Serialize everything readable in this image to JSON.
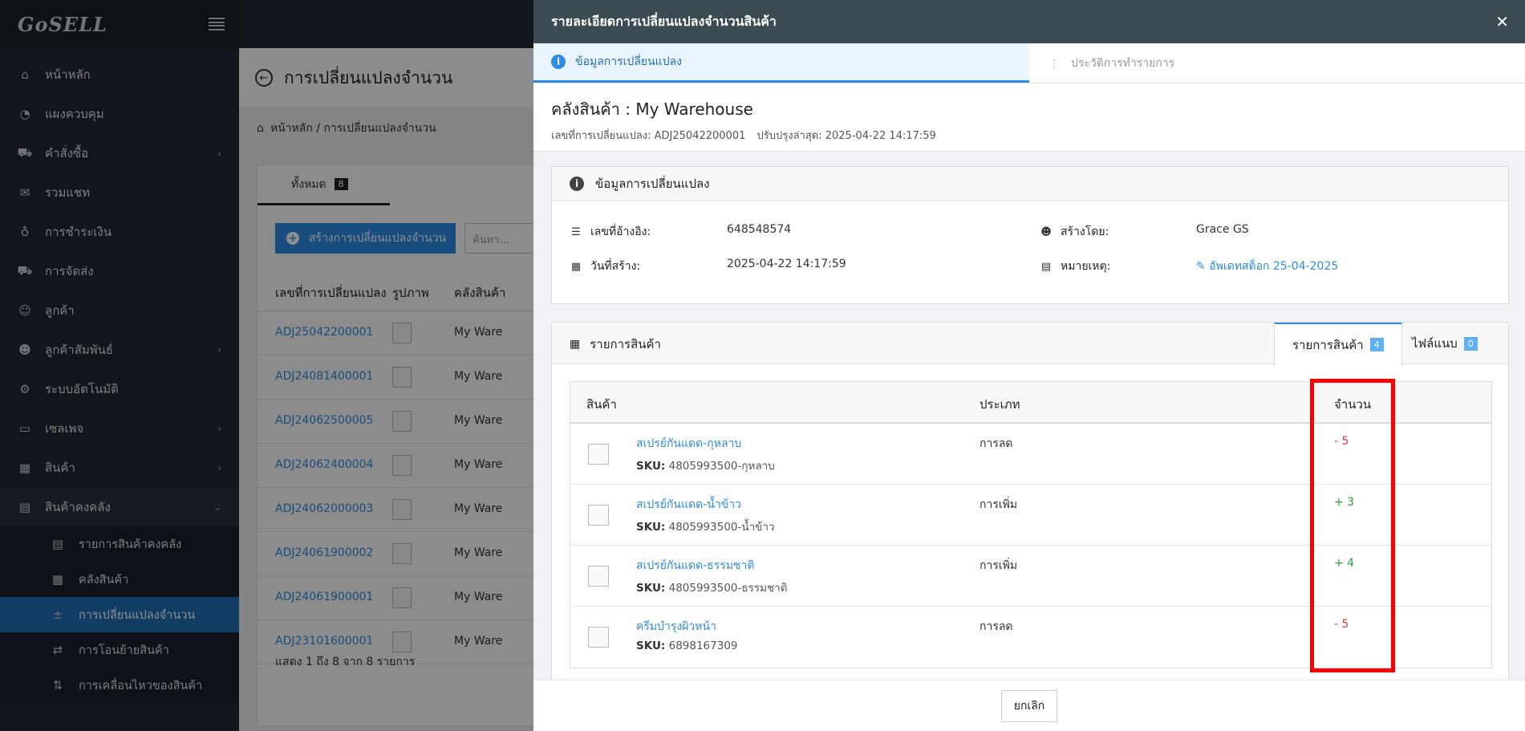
{
  "app": {
    "logo": "GoSELL"
  },
  "sidebar": {
    "items": [
      {
        "label": "หน้าหลัก",
        "icon": "home-icon"
      },
      {
        "label": "แผงควบคุม",
        "icon": "dashboard-icon"
      },
      {
        "label": "คำสั่งซื้อ",
        "icon": "cart-icon"
      },
      {
        "label": "รวมแชท",
        "icon": "chat-icon"
      },
      {
        "label": "การชำระเงิน",
        "icon": "money-bag-icon"
      },
      {
        "label": "การจัดส่ง",
        "icon": "truck-icon"
      },
      {
        "label": "ลูกค้า",
        "icon": "users-icon"
      },
      {
        "label": "ลูกค้าสัมพันธ์",
        "icon": "crm-icon"
      },
      {
        "label": "ระบบอัตโนมัติ",
        "icon": "robot-icon"
      },
      {
        "label": "เซลเพจ",
        "icon": "window-icon"
      },
      {
        "label": "สินค้า",
        "icon": "boxes-icon"
      },
      {
        "label": "สินค้าคงคลัง",
        "icon": "warehouse-icon"
      }
    ],
    "sub_items": [
      {
        "label": "รายการสินค้าคงคลัง",
        "icon": "warehouse-list-icon"
      },
      {
        "label": "คลังสินค้า",
        "icon": "warehouse-icon"
      },
      {
        "label": "การเปลี่ยนแปลงจำนวน",
        "icon": "plus-minus-icon"
      },
      {
        "label": "การโอนย้ายสินค้า",
        "icon": "transfer-icon"
      },
      {
        "label": "การเคลื่อนไหวของสินค้า",
        "icon": "sort-arrows-icon"
      }
    ]
  },
  "page": {
    "title": "การเปลี่ยนแปลงจำนวน",
    "breadcrumb": "หน้าหลัก / การเปลี่ยนแปลงจำนวน",
    "tab_all": "ทั้งหมด",
    "tab_all_count": "8",
    "create_button": "สร้างการเปลี่ยนแปลงจำนวน",
    "search_placeholder": "ค้นหา...",
    "columns": [
      "เลขที่การเปลี่ยนแปลง",
      "รูปภาพ",
      "คลังสินค้า"
    ],
    "rows": [
      {
        "id": "ADJ25042200001",
        "warehouse": "My Ware"
      },
      {
        "id": "ADJ24081400001",
        "warehouse": "My Ware"
      },
      {
        "id": "ADJ24062500005",
        "warehouse": "My Ware"
      },
      {
        "id": "ADJ24062400004",
        "warehouse": "My Ware"
      },
      {
        "id": "ADJ24062000003",
        "warehouse": "My Ware"
      },
      {
        "id": "ADJ24061900002",
        "warehouse": "My Ware"
      },
      {
        "id": "ADJ24061900001",
        "warehouse": "My Ware"
      },
      {
        "id": "ADJ23101600001",
        "warehouse": "My Ware"
      }
    ],
    "footer": "แสดง 1 ถึง 8 จาก 8 รายการ"
  },
  "drawer": {
    "title": "รายละเอียดการเปลี่ยนแปลงจำนวนสินค้า",
    "tabs": [
      "ข้อมูลการเปลี่ยนแปลง",
      "ประวัติการทำรายการ"
    ],
    "warehouse_title": "คลังสินค้า : My Warehouse",
    "adjust_no_label": "เลขที่การเปลี่ยนแปลง: ADJ25042200001",
    "updated_label": "ปรับปรุงล่าสุด: 2025-04-22 14:17:59",
    "info": {
      "heading": "ข้อมูลการเปลี่ยนแปลง",
      "ref_label": "เลขที่อ้างอิง:",
      "ref_value": "648548574",
      "created_label": "วันที่สร้าง:",
      "created_value": "2025-04-22 14:17:59",
      "by_label": "สร้างโดย:",
      "by_value": "Grace GS",
      "note_label": "หมายเหตุ:",
      "note_value": "อัพเดทสต็อก 25-04-2025"
    },
    "items": {
      "heading": "รายการสินค้า",
      "tab_items": "รายการสินค้า",
      "tab_items_count": "4",
      "tab_files": "ไฟล์แนบ",
      "tab_files_count": "0",
      "columns": {
        "product": "สินค้า",
        "type": "ประเภท",
        "qty": "จำนวน"
      },
      "sku_label": "SKU:",
      "rows": [
        {
          "name": "สเปรย์กันแดด-กุหลาบ",
          "sku": "4805993500-กุหลาบ",
          "type": "การลด",
          "qty": "- 5",
          "sign": "neg"
        },
        {
          "name": "สเปรย์กันแดด-น้ำข้าว",
          "sku": "4805993500-น้ำข้าว",
          "type": "การเพิ่ม",
          "qty": "+ 3",
          "sign": "pos"
        },
        {
          "name": "สเปรย์กันแดด-ธรรมชาติ",
          "sku": "4805993500-ธรรมชาติ",
          "type": "การเพิ่ม",
          "qty": "+ 4",
          "sign": "pos"
        },
        {
          "name": "ครีมบำรุงผิวหน้า",
          "sku": "6898167309",
          "type": "การลด",
          "qty": "- 5",
          "sign": "neg"
        }
      ]
    },
    "cancel_button": "ยกเลิก"
  },
  "colors": {
    "accent": "#2d8ce4",
    "sidebar": "#1f2733",
    "negative": "#e03a3a",
    "positive": "#2e9e3a",
    "highlight": "#ff0000"
  }
}
